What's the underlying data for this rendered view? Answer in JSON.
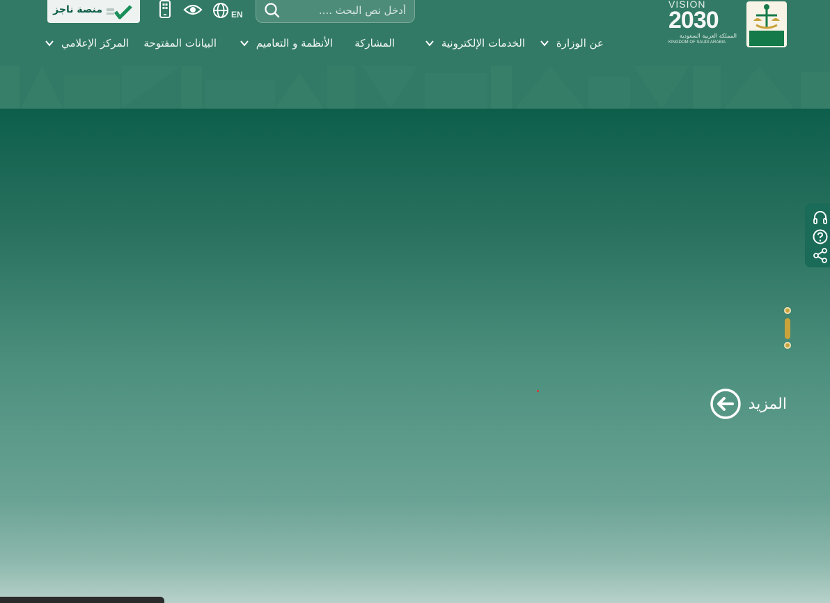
{
  "header": {
    "vision": {
      "word": "VISION",
      "number": "2030",
      "arabic": "المملكة العربية السعودية",
      "english": "KINGDOM OF SAUDI ARABIA"
    },
    "search": {
      "placeholder": "أدخل نص البحث ...."
    },
    "lang_label": "EN",
    "najiz_label": "منصة ناجز",
    "najiz_mark": "ناجز najiz"
  },
  "nav": {
    "items": [
      {
        "label": "عن الوزارة",
        "has_dropdown": true
      },
      {
        "label": "الخدمات الإلكترونية",
        "has_dropdown": true
      },
      {
        "label": "المشاركة",
        "has_dropdown": false
      },
      {
        "label": "الأنظمة و التعاميم",
        "has_dropdown": true
      },
      {
        "label": "البيانات المفتوحة",
        "has_dropdown": false
      },
      {
        "label": "المركز الإعلامي",
        "has_dropdown": true
      }
    ]
  },
  "hero": {
    "more_label": "المزيد"
  },
  "side_tools": [
    "headset-icon",
    "help-icon",
    "share-icon"
  ],
  "colors": {
    "primary": "#0d5f4c",
    "header": "#327a65",
    "gold": "#c9a23a",
    "najiz_bg": "#eef2f0"
  }
}
